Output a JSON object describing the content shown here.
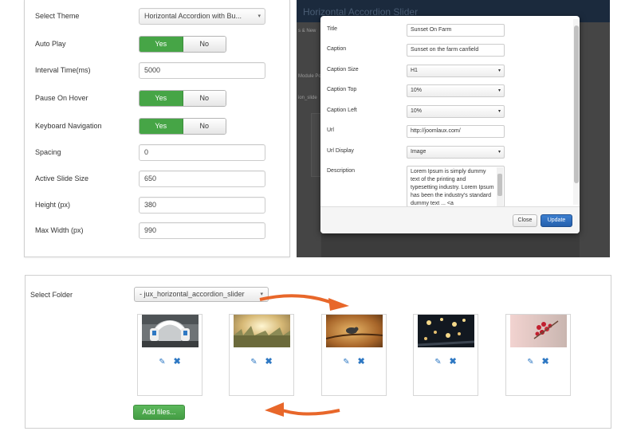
{
  "settings": {
    "rows": [
      {
        "label": "Select Theme",
        "type": "select",
        "value": "Horizontal Accordion with Bu..."
      },
      {
        "label": "Auto Play",
        "type": "toggle",
        "on": "Yes",
        "off": "No"
      },
      {
        "label": "Interval Time(ms)",
        "type": "input",
        "value": "5000"
      },
      {
        "label": "Pause On Hover",
        "type": "toggle",
        "on": "Yes",
        "off": "No"
      },
      {
        "label": "Keyboard Navigation",
        "type": "toggle",
        "on": "Yes",
        "off": "No"
      },
      {
        "label": "Spacing",
        "type": "input",
        "value": "0"
      },
      {
        "label": "Active Slide Size",
        "type": "input",
        "value": "650"
      },
      {
        "label": "Height (px)",
        "type": "input",
        "value": "380"
      },
      {
        "label": "Max Width (px)",
        "type": "input",
        "value": "990"
      }
    ]
  },
  "modal_screen": {
    "background_title": "Horizontal Accordion Slider",
    "bg_fragments": [
      "s & New",
      "Module Po",
      "ion_slide"
    ],
    "fields": [
      {
        "label": "Title",
        "type": "input",
        "value": "Sunset On Farm"
      },
      {
        "label": "Caption",
        "type": "input",
        "value": "Sunset on the farm canfield"
      },
      {
        "label": "Caption Size",
        "type": "select",
        "value": "H1"
      },
      {
        "label": "Caption Top",
        "type": "select",
        "value": "10%"
      },
      {
        "label": "Caption Left",
        "type": "select",
        "value": "10%"
      },
      {
        "label": "Url",
        "type": "input",
        "value": "http://joomlaux.com/"
      },
      {
        "label": "Url Display",
        "type": "select",
        "value": "Image"
      }
    ],
    "description_label": "Description",
    "description_text": "Lorem Ipsum is simply dummy text of the printing and typesetting industry. Lorem Ipsum has been the industry's standard dummy text ... <a",
    "close_label": "Close",
    "update_label": "Update"
  },
  "folder": {
    "label": "Select Folder",
    "selected": "- jux_horizontal_accordion_slider",
    "images": [
      {
        "name": "headphones-image"
      },
      {
        "name": "meadow-sunset-image"
      },
      {
        "name": "bird-on-branch-image"
      },
      {
        "name": "night-lights-image"
      },
      {
        "name": "red-berries-image"
      }
    ],
    "add_files_label": "Add files..."
  },
  "colors": {
    "green": "#46a546",
    "blue_button": "#2560ad",
    "orange_arrow": "#e8672a",
    "icon_blue": "#2e78c3"
  },
  "icons": {
    "edit": "✎",
    "delete": "✖",
    "caret": "▾"
  }
}
